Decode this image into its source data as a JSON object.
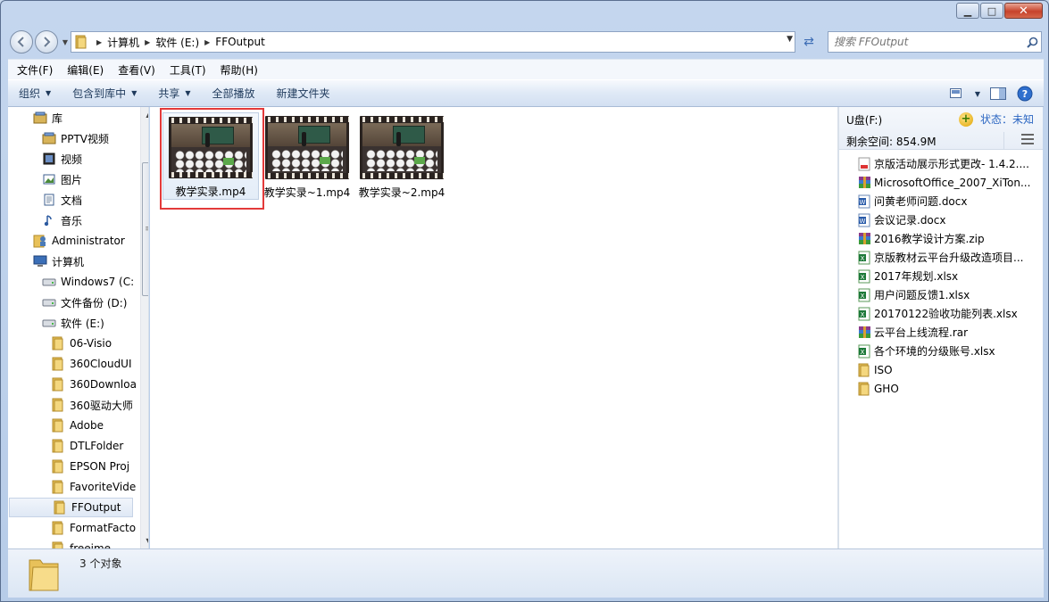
{
  "window": {
    "caption_buttons": [
      "minimize",
      "maximize",
      "close"
    ]
  },
  "nav": {
    "breadcrumb": [
      "计算机",
      "软件 (E:)",
      "FFOutput"
    ],
    "search_placeholder": "搜索 FFOutput"
  },
  "menubar": {
    "items": [
      "文件(F)",
      "编辑(E)",
      "查看(V)",
      "工具(T)",
      "帮助(H)"
    ]
  },
  "cmdbar": {
    "organize": "组织",
    "include_library": "包含到库中",
    "share": "共享",
    "play_all": "全部播放",
    "new_folder": "新建文件夹"
  },
  "tree": [
    {
      "label": "库",
      "icon": "library-icon",
      "level": 0
    },
    {
      "label": "PPTV视频",
      "icon": "library-icon",
      "level": 1
    },
    {
      "label": "视频",
      "icon": "video-library-icon",
      "level": 1
    },
    {
      "label": "图片",
      "icon": "picture-library-icon",
      "level": 1
    },
    {
      "label": "文档",
      "icon": "document-library-icon",
      "level": 1
    },
    {
      "label": "音乐",
      "icon": "music-library-icon",
      "level": 1
    },
    {
      "label": "Administrator",
      "icon": "user-folder-icon",
      "level": 0
    },
    {
      "label": "计算机",
      "icon": "computer-icon",
      "level": 0
    },
    {
      "label": "Windows7 (C:",
      "icon": "drive-icon",
      "level": 1
    },
    {
      "label": "文件备份 (D:)",
      "icon": "drive-icon",
      "level": 1
    },
    {
      "label": "软件 (E:)",
      "icon": "drive-icon",
      "level": 1
    },
    {
      "label": "06-Visio",
      "icon": "folder-icon",
      "level": 2
    },
    {
      "label": "360CloudUI",
      "icon": "folder-icon",
      "level": 2
    },
    {
      "label": "360Downloa",
      "icon": "folder-icon",
      "level": 2
    },
    {
      "label": "360驱动大师",
      "icon": "folder-icon",
      "level": 2
    },
    {
      "label": "Adobe",
      "icon": "folder-icon",
      "level": 2
    },
    {
      "label": "DTLFolder",
      "icon": "folder-icon",
      "level": 2
    },
    {
      "label": "EPSON Proj",
      "icon": "folder-icon",
      "level": 2
    },
    {
      "label": "FavoriteVide",
      "icon": "folder-icon",
      "level": 2
    },
    {
      "label": "FFOutput",
      "icon": "folder-icon",
      "level": 2,
      "selected": true
    },
    {
      "label": "FormatFacto",
      "icon": "folder-icon",
      "level": 2
    },
    {
      "label": "freeime",
      "icon": "folder-icon",
      "level": 2
    }
  ],
  "files": [
    {
      "name": "教学实录.mp4",
      "selected": true
    },
    {
      "name": "教学实录~1.mp4",
      "selected": false
    },
    {
      "name": "教学实录~2.mp4",
      "selected": false
    }
  ],
  "details": {
    "title": "U盘(F:)",
    "status": "状态：未知",
    "free_space": "剩余空间: 854.9M",
    "items": [
      {
        "name": "京版活动展示形式更改- 1.4.2....",
        "icon": "pdf-icon"
      },
      {
        "name": "MicrosoftOffice_2007_XiTon...",
        "icon": "archive-icon"
      },
      {
        "name": "问黄老师问题.docx",
        "icon": "word-icon"
      },
      {
        "name": "会议记录.docx",
        "icon": "word-icon"
      },
      {
        "name": "2016教学设计方案.zip",
        "icon": "archive-icon"
      },
      {
        "name": "京版教材云平台升级改造项目...",
        "icon": "excel-icon"
      },
      {
        "name": "2017年规划.xlsx",
        "icon": "excel-icon"
      },
      {
        "name": "用户问题反馈1.xlsx",
        "icon": "excel-icon"
      },
      {
        "name": "20170122验收功能列表.xlsx",
        "icon": "excel-icon"
      },
      {
        "name": "云平台上线流程.rar",
        "icon": "archive-icon"
      },
      {
        "name": "各个环境的分级账号.xlsx",
        "icon": "excel-icon"
      },
      {
        "name": "ISO",
        "icon": "folder-icon"
      },
      {
        "name": "GHO",
        "icon": "folder-icon"
      }
    ]
  },
  "statusbar": {
    "count": "3 个对象"
  },
  "colors": {
    "selection_border": "#e33a3a",
    "link_blue": "#2b66c2",
    "folder_yellow": "#e8c15a"
  }
}
